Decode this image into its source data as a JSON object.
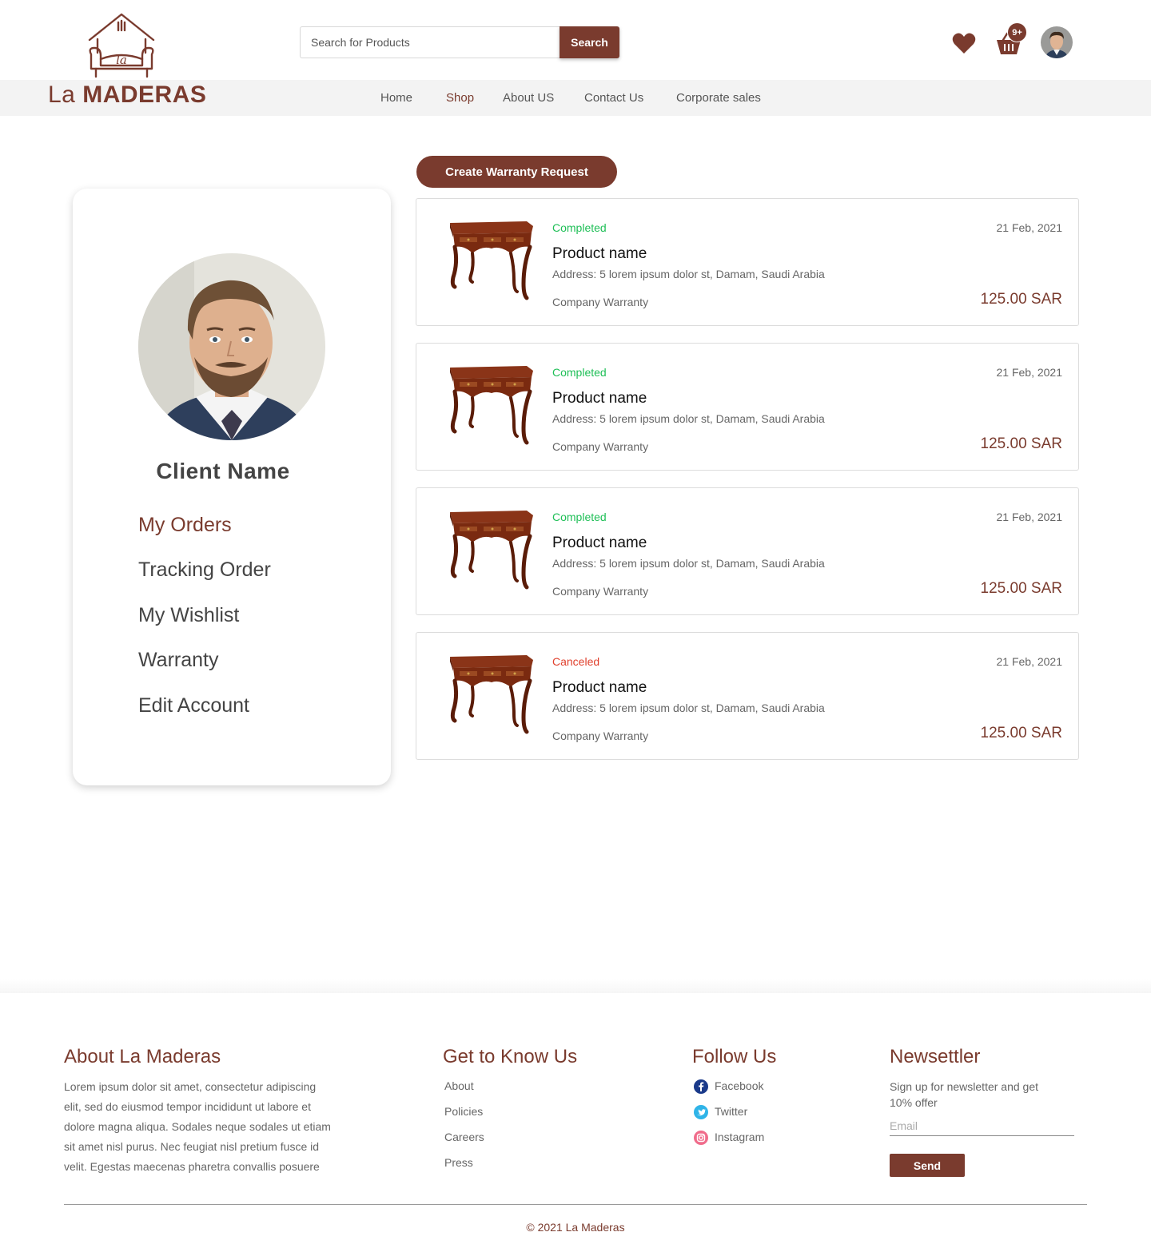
{
  "brand": {
    "logo_prefix": "La",
    "logo_suffix": "MADERAS",
    "accent_color": "#7a3b2e"
  },
  "search": {
    "placeholder": "Search for Products",
    "button_label": "Search"
  },
  "header": {
    "cart_badge": "9+",
    "wishlist_icon": "heart-icon",
    "cart_icon": "basket-icon"
  },
  "nav": {
    "items": [
      {
        "label": "Home"
      },
      {
        "label": "Shop"
      },
      {
        "label": "About US"
      },
      {
        "label": "Contact Us"
      },
      {
        "label": "Corporate sales"
      }
    ],
    "active": "Shop"
  },
  "profile": {
    "name": "Client Name",
    "menu": [
      {
        "label": "My Orders"
      },
      {
        "label": "Tracking Order"
      },
      {
        "label": "My Wishlist"
      },
      {
        "label": "Warranty"
      },
      {
        "label": "Edit Account"
      }
    ],
    "active": "My Orders"
  },
  "actions": {
    "create_warranty": "Create Warranty Request"
  },
  "orders": [
    {
      "status": "Completed",
      "date": "21 Feb, 2021",
      "name": "Product name",
      "address": "Address: 5 lorem ipsum dolor st, Damam, Saudi Arabia",
      "warranty": "Company Warranty",
      "price": "125.00 SAR"
    },
    {
      "status": "Completed",
      "date": "21 Feb, 2021",
      "name": "Product name",
      "address": "Address: 5 lorem ipsum dolor st, Damam, Saudi Arabia",
      "warranty": "Company Warranty",
      "price": "125.00 SAR"
    },
    {
      "status": "Completed",
      "date": "21 Feb, 2021",
      "name": "Product name",
      "address": "Address: 5 lorem ipsum dolor st, Damam, Saudi Arabia",
      "warranty": "Company Warranty",
      "price": "125.00 SAR"
    },
    {
      "status": "Canceled",
      "date": "21 Feb, 2021",
      "name": "Product name",
      "address": "Address: 5 lorem ipsum dolor st, Damam, Saudi Arabia",
      "warranty": "Company Warranty",
      "price": "125.00 SAR"
    }
  ],
  "status_colors": {
    "Completed": "#1fbf57",
    "Canceled": "#e0412e"
  },
  "footer": {
    "about": {
      "title": "About La Maderas",
      "text": "Lorem ipsum dolor sit amet, consectetur adipiscing elit, sed do eiusmod tempor incididunt ut labore et dolore magna aliqua. Sodales neque sodales ut etiam sit amet nisl purus. Nec feugiat nisl pretium fusce id velit. Egestas maecenas pharetra convallis posuere"
    },
    "know": {
      "title": "Get to Know Us",
      "links": [
        {
          "label": "About"
        },
        {
          "label": "Policies"
        },
        {
          "label": "Careers"
        },
        {
          "label": "Press"
        }
      ]
    },
    "follow": {
      "title": "Follow Us",
      "links": [
        {
          "label": "Facebook",
          "icon": "facebook-icon",
          "color": "#1a3a8a"
        },
        {
          "label": "Twitter",
          "icon": "twitter-icon",
          "color": "#2fb4e8"
        },
        {
          "label": "Instagram",
          "icon": "instagram-icon",
          "color": "#e4405f"
        }
      ]
    },
    "newsletter": {
      "title": "Newsettler",
      "text": "Sign up for newsletter and get 10% offer",
      "email_placeholder": "Email",
      "button_label": "Send"
    },
    "copyright": "© 2021 La Maderas"
  }
}
